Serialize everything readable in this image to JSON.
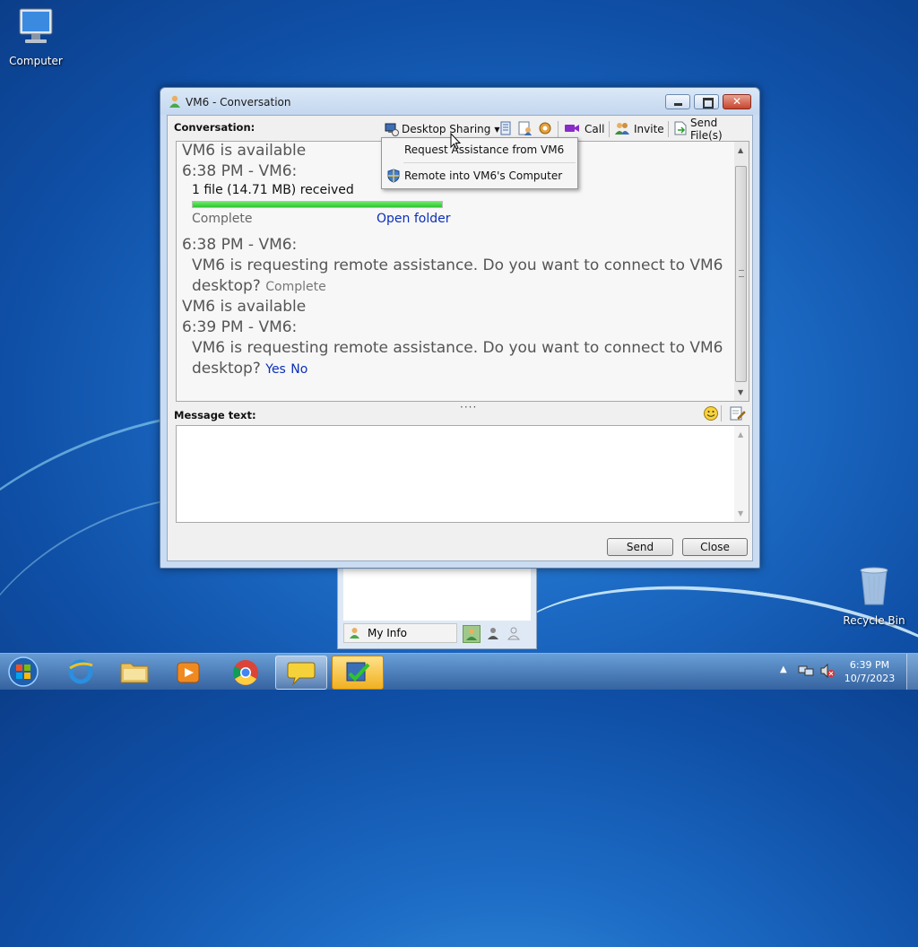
{
  "desktop": {
    "icons": [
      {
        "label": "Computer"
      },
      {
        "label": "Recycle Bin"
      }
    ]
  },
  "window": {
    "title": "VM6 - Conversation",
    "conversation_label": "Conversation:",
    "toolbar": {
      "desktop_sharing": "Desktop Sharing",
      "call": "Call",
      "invite": "Invite",
      "send_files": "Send File(s)"
    },
    "messages": {
      "m1": "VM6 is available",
      "m2": "6:38 PM - VM6:",
      "file_received": "1 file (14.71 MB) received",
      "progress": 1.0,
      "complete": "Complete",
      "open_folder": "Open folder",
      "m3": "6:38 PM - VM6:",
      "m4a": "VM6 is requesting remote assistance. Do you want to connect to VM6",
      "m4b": "desktop?",
      "m4_status": "Complete",
      "m5": "VM6 is available",
      "m6": "6:39 PM - VM6:",
      "m7a": "VM6 is requesting remote assistance. Do you want to connect to VM6",
      "m7b": "desktop?",
      "yes": "Yes",
      "no": "No"
    },
    "message_text_label": "Message text:",
    "send": "Send",
    "close": "Close"
  },
  "dropdown": {
    "items": [
      "Request Assistance from VM6",
      "Remote into VM6's Computer"
    ]
  },
  "buddy_window": {
    "my_info": "My Info"
  },
  "taskbar": {
    "time": "6:39 PM",
    "date": "10/7/2023"
  },
  "colors": {
    "link": "#0b2fb8",
    "progress": "#2fc42f",
    "close_button": "#c8452e"
  }
}
